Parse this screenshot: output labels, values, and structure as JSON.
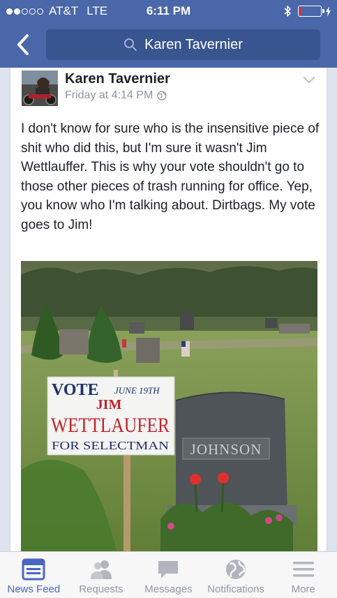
{
  "status_bar": {
    "signal_filled": 2,
    "signal_total": 5,
    "carrier": "AT&T",
    "network": "LTE",
    "time": "6:11 PM",
    "battery_level_percent": 10
  },
  "header": {
    "back_icon": "chevron-left-icon",
    "search_text": "Karen Tavernier",
    "search_icon": "search-icon"
  },
  "post": {
    "author": "Karen Tavernier",
    "timestamp": "Friday at 4:14 PM",
    "privacy_icon": "globe-icon",
    "menu_icon": "chevron-down-icon",
    "text": "I don't know for sure who is the insensitive piece of shit who did this, but I'm sure it wasn't Jim Wettlauffer. This is why your vote shouldn't go to those other pieces of trash running for office. Yep, you know who I'm talking about. Dirtbags. My vote goes to Jim!",
    "photo": {
      "sign_vote": "VOTE",
      "sign_date": "JUNE 19TH",
      "sign_name_first": "JIM",
      "sign_name_last": "WETTLAUFER",
      "sign_office": "FOR SELECTMAN",
      "headstone_name": "JOHNSON"
    }
  },
  "tabbar": {
    "tabs": [
      {
        "label": "News Feed",
        "icon": "news-feed-icon",
        "active": true
      },
      {
        "label": "Requests",
        "icon": "friends-icon",
        "active": false
      },
      {
        "label": "Messages",
        "icon": "messages-icon",
        "active": false
      },
      {
        "label": "Notifications",
        "icon": "globe-icon",
        "active": false
      },
      {
        "label": "More",
        "icon": "menu-icon",
        "active": false
      }
    ]
  },
  "colors": {
    "brand_blue": "#4a67a9",
    "search_bg": "#39558f",
    "active_tab": "#4a67c0",
    "battery_low": "#e0303a"
  }
}
